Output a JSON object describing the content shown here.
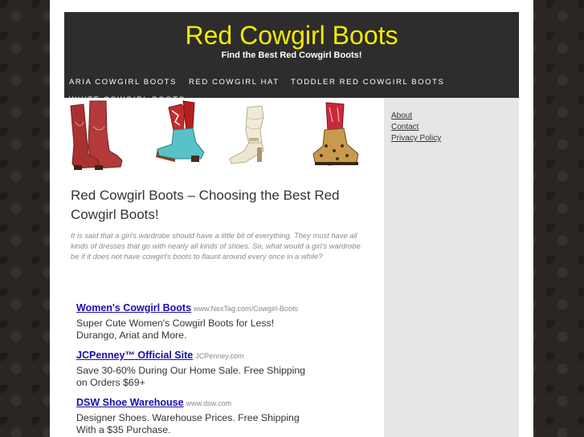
{
  "header": {
    "site_title": "Red Cowgirl Boots",
    "tagline": "Find the Best Red Cowgirl Boots!"
  },
  "nav": {
    "items": [
      {
        "label": "ARIA COWGIRL BOOTS"
      },
      {
        "label": "RED COWGIRL HAT"
      },
      {
        "label": "TODDLER RED COWGIRL BOOTS"
      },
      {
        "label": "WHITE COWGIRL BOOTS"
      }
    ]
  },
  "hero": {
    "images": [
      {
        "icon": "red-cowboy-boot-icon"
      },
      {
        "icon": "red-turquoise-boot-icon"
      },
      {
        "icon": "white-slouch-boot-icon"
      },
      {
        "icon": "leopard-red-boot-icon"
      }
    ]
  },
  "post": {
    "title": "Red Cowgirl Boots – Choosing the Best Red Cowgirl Boots!",
    "intro": "It is said that a girl's wardrobe should have a little bit of everything. They must have all kinds of dresses that go with nearly all kinds of shoes. So, what would a girl's wardrobe be if it does not have cowgirl's boots to flaunt around every once in a while?"
  },
  "ads": [
    {
      "title": "Women's Cowgirl Boots",
      "url": "www.NexTag.com/Cowgirl-Boots",
      "desc": "Super Cute Women's Cowgirl Boots for Less! Durango, Ariat and More."
    },
    {
      "title": "JCPenney™ Official Site",
      "url": "JCPenney.com",
      "desc": "Save 30-60% During Our Home Sale. Free Shipping on Orders $69+"
    },
    {
      "title": "DSW Shoe Warehouse",
      "url": "www.dsw.com",
      "desc": "Designer Shoes. Warehouse Prices. Free Shipping With a $35 Purchase."
    }
  ],
  "sidebar": {
    "links": [
      {
        "label": "About"
      },
      {
        "label": "Contact"
      },
      {
        "label": "Privacy Policy"
      }
    ]
  },
  "colors": {
    "title_yellow": "#f3ea00",
    "header_bg": "#2e2c2c",
    "ad_link_blue": "#1a0dab",
    "sidebar_bg": "#e6e6e6"
  }
}
